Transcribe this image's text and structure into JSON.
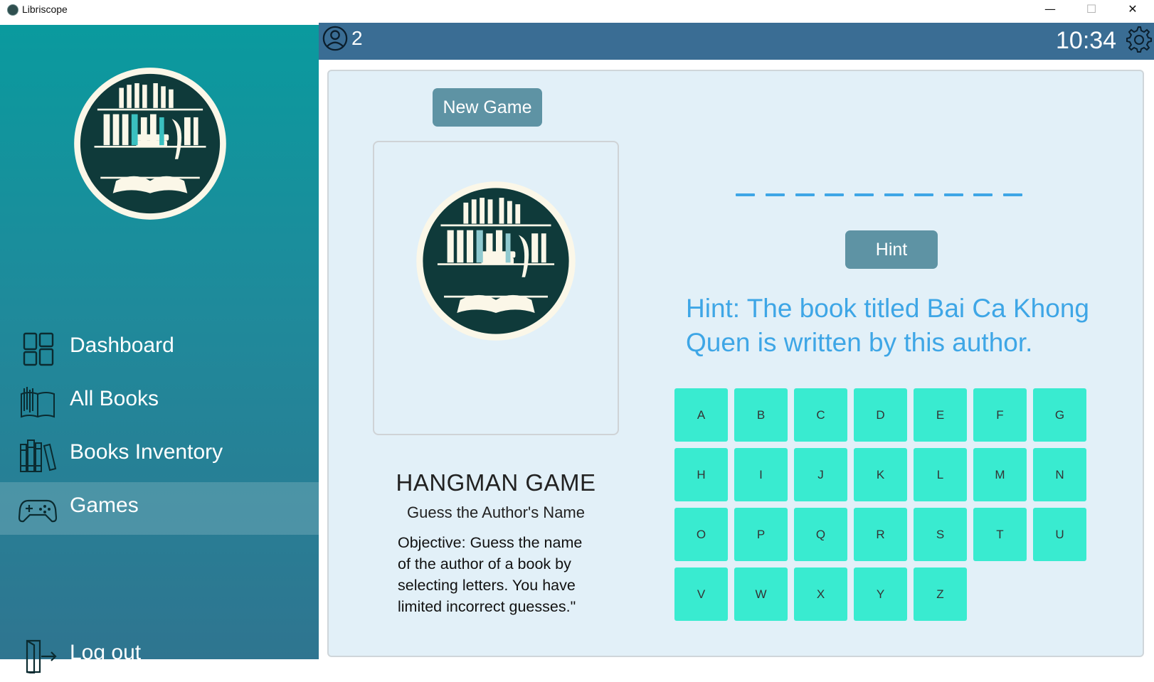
{
  "window": {
    "title": "Libriscope",
    "controls": {
      "minimize": "—",
      "maximize": "☐",
      "close": "✕"
    }
  },
  "header": {
    "user_count": "2",
    "clock": "10:34",
    "icons": {
      "user": "user-icon",
      "settings": "gear-icon"
    }
  },
  "sidebar": {
    "logo": "library-logo",
    "items": [
      {
        "label": "Dashboard",
        "icon": "dashboard-icon",
        "active": false
      },
      {
        "label": "All Books",
        "icon": "open-book-icon",
        "active": false
      },
      {
        "label": "Books Inventory",
        "icon": "books-shelf-icon",
        "active": false
      },
      {
        "label": "Games",
        "icon": "gamepad-icon",
        "active": true
      }
    ],
    "logout": {
      "label": "Log out",
      "icon": "logout-icon"
    }
  },
  "game": {
    "new_game_label": "New Game",
    "title": "HANGMAN GAME",
    "subtitle": "Guess the Author's Name",
    "objective": "Objective: Guess the name of the author of a book by selecting letters. You have limited incorrect guesses.\"",
    "word_slots": 10,
    "hint_button": "Hint",
    "hint_text": "Hint: The book titled Bai Ca Khong Quen is written by this author.",
    "letters": [
      "A",
      "B",
      "C",
      "D",
      "E",
      "F",
      "G",
      "H",
      "I",
      "J",
      "K",
      "L",
      "M",
      "N",
      "O",
      "P",
      "Q",
      "R",
      "S",
      "T",
      "U",
      "V",
      "W",
      "X",
      "Y",
      "Z"
    ]
  },
  "colors": {
    "header": "#3a6d94",
    "sidebar_top": "#0a9a9e",
    "sidebar_bottom": "#2f7590",
    "main_bg": "#e2f0f8",
    "button": "#5e93a4",
    "key": "#39ebd0",
    "hint": "#3ea6e6"
  }
}
